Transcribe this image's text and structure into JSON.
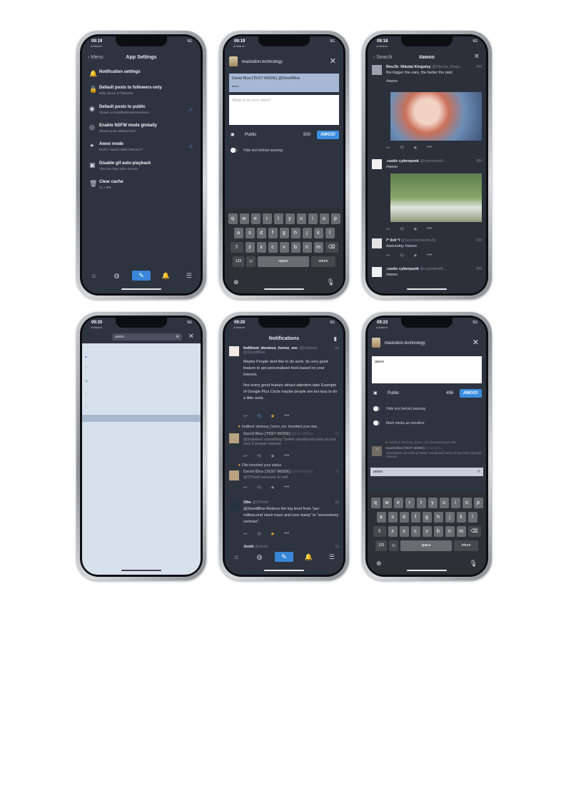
{
  "phones": {
    "settings": {
      "time": "09:19",
      "status_back": "◂ Search",
      "signal": "5G",
      "back_label": "Menu",
      "title": "App Settings",
      "items": [
        {
          "title": "Notification settings",
          "sub": ""
        },
        {
          "title": "Default posts to followers-only",
          "sub": "Only shown to followers"
        },
        {
          "title": "Default posts to public",
          "sub": "Shown on local/federated timelines"
        },
        {
          "title": "Enable NSFW mode globally",
          "sub": "Shows posts without blurs"
        },
        {
          "title": "Awoo mode",
          "sub": "DON'T AWOO $350 PENALTY"
        },
        {
          "title": "Disable gif auto-playback",
          "sub": "This can help older devices"
        },
        {
          "title": "Clear cache",
          "sub": "11.4 MB"
        }
      ]
    },
    "compose1": {
      "time": "09:19",
      "status_back": "◂ Search",
      "signal": "5G",
      "account": "mastodon.technology",
      "reply_to": "David Blue [TEST MODE] @DavidBlue",
      "reply_text": "awoo",
      "placeholder": "What is on your mind?",
      "visibility": "Public",
      "count": "500",
      "submit": "AWOO!",
      "toggle_label": "Hide text behind warning"
    },
    "hashtag": {
      "time": "09:18",
      "status_back": "◂ Search",
      "signal": "5G",
      "back_label": "Search",
      "title": "#awoo",
      "posts": [
        {
          "name": "Rev.Dr. Nikolai Kingsley",
          "handle": "@Nikolai_Kings...",
          "time": "9M",
          "body": "the bigger the ears, the better the patz",
          "tag": "#awoo"
        },
        {
          "name": ".rustic cyberpunk",
          "handle": "@cyphdmadl...",
          "time": "9M",
          "body": "#awoo"
        },
        {
          "name": "/* 0x0 */",
          "handle": "@rancidumbrella.fly",
          "time": "5M",
          "body": "#awooday #awoo"
        },
        {
          "name": ".rustic cyberpunk",
          "handle": "@cyphdmadl...",
          "time": "5M",
          "body": "#awoo"
        }
      ]
    },
    "search": {
      "time": "09:20",
      "status_back": "◂ Search",
      "signal": "5G",
      "query": "awoo"
    },
    "notifications": {
      "time": "09:20",
      "status_back": "◂ Search",
      "signal": "5G",
      "title": "Notifications",
      "items": [
        {
          "name": "Indiitoot :devious_horns_ms:",
          "handle": "@indiitoot",
          "time": "2y",
          "sub": "@DavidBlue",
          "body1": "Maybe People dont like to do work. Its very good feature to get personalised feed based on your interest.",
          "body2": "Not every good feature attract attention take Example of Google Plus Circle maybe people are too lazy to do a little work."
        },
        {
          "fav": "Indiitoot :devious_horns_ms: favorited your stat...",
          "name": "David Blue [TEST MODE]",
          "handle": "@DavidBlue",
          "time": "2y",
          "body": "@indiawoo something Twitter introduced early on but only 5 people noticed."
        },
        {
          "fav": "Olie favorited your status",
          "name": "David Blue [TEST MODE]",
          "handle": "@DavidBlue",
          "time": "2y",
          "body": "@OTheB welcome to hell"
        },
        {
          "name": "Olie",
          "handle": "@OTheB",
          "time": "2y",
          "body": "@DavidBlue Reduce the log level from \"per-millisecond stack trace and core dump\" to \"excessively verbose\"."
        },
        {
          "name": "Joshi",
          "handle": "@Joshi",
          "time": "2y",
          "body": ""
        }
      ]
    },
    "compose2": {
      "time": "09:22",
      "status_back": "◂ Search",
      "signal": "5G",
      "account": "mastodon.technology",
      "text": "awoo",
      "visibility": "Public",
      "count": "496",
      "submit": "AWOO!",
      "toggle1": "Hide text behind warning",
      "toggle2": "Mark media as sensitive",
      "fav_line": "Indiitoot :devious_horns_ms: favorited your stat...",
      "under_name": "David Blue [TEST MODE]",
      "under_handle": "@DavidBlue",
      "under_body": "@indiawoo something Twitter introduced early on but only 5 people noticed.",
      "autocomplete": "awoo"
    }
  },
  "keyboard": {
    "row1": [
      "q",
      "w",
      "e",
      "r",
      "t",
      "y",
      "u",
      "i",
      "o",
      "p"
    ],
    "row2": [
      "a",
      "s",
      "d",
      "f",
      "g",
      "h",
      "j",
      "k",
      "l"
    ],
    "row3": [
      "z",
      "x",
      "c",
      "v",
      "b",
      "n",
      "m"
    ],
    "num": "123",
    "space": "space",
    "return": "return"
  },
  "colors": {
    "accent": "#3b8de0",
    "bg": "#2e3340",
    "search_bg": "#d7e1ec"
  }
}
